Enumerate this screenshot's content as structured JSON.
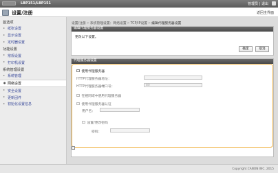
{
  "topbar": {
    "device_name": "LBP151/LBP151",
    "user_info": "管理员 | 退出"
  },
  "header": {
    "title": "设置/注册",
    "portal_link": "返回主界面"
  },
  "sidebar": {
    "sections": [
      {
        "heading": "首选项",
        "items": [
          "纸张设置",
          "显示设置",
          "定时器设置"
        ]
      },
      {
        "heading": "功能设置",
        "items": [
          "常规设置",
          "打印机设置"
        ]
      },
      {
        "heading": "系统管理设置",
        "items": [
          "系统管理",
          "网络设置",
          "安全设置",
          "更新固件",
          "初始化设置信息"
        ]
      }
    ],
    "active": "网络设置"
  },
  "breadcrumb": {
    "items": [
      "设置/注册",
      "系统管理设置：网络设置",
      "TCP/IP设置",
      "编辑代理服务器设置"
    ],
    "separator": ">"
  },
  "edit_panel": {
    "title": "编辑代理服务器设置",
    "message": "更改以下设置。",
    "ok_label": "确定",
    "cancel_label": "取消"
  },
  "proxy_panel": {
    "title": "代理服务器设置",
    "use_proxy_label": "使用代理服务器",
    "http_address_label": "HTTP代理服务器地址：",
    "http_address_value": "",
    "http_port_label": "HTTP代理服务器端口号：",
    "http_port_value": "80",
    "same_domain_label": "在相同域中使用代理服务器",
    "use_auth_label": "使用代理服务器认证",
    "username_label": "用户名：",
    "set_password_label": "设置/更改密码",
    "password_label": "密码："
  },
  "footer": {
    "copyright": "Copyright CANON INC. 2015"
  },
  "icons": [
    "settings-icon",
    "logo-icon",
    "user-icon",
    "back-to-top-icon"
  ],
  "colors": {
    "highlight_border": "#f1b64b",
    "header_bar": "#555555",
    "link": "#3a4a9a"
  }
}
